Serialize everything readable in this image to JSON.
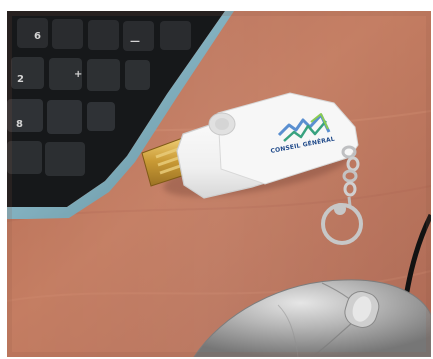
{
  "photo": {
    "logo_main": "CONSEIL GÉNÉRAL",
    "logo_sub": "",
    "key_labels": [
      "6",
      "+",
      "2",
      "—",
      "8"
    ]
  },
  "colors": {
    "desk": "#c47d62",
    "drive_body": "#f6f6f6",
    "usb_connector": "#d7a43c",
    "keyboard": "#1a1b1d",
    "keyboard_edge": "#8fc0cf",
    "mouse": "#b4b4b4",
    "cable": "#0f0f0f"
  }
}
